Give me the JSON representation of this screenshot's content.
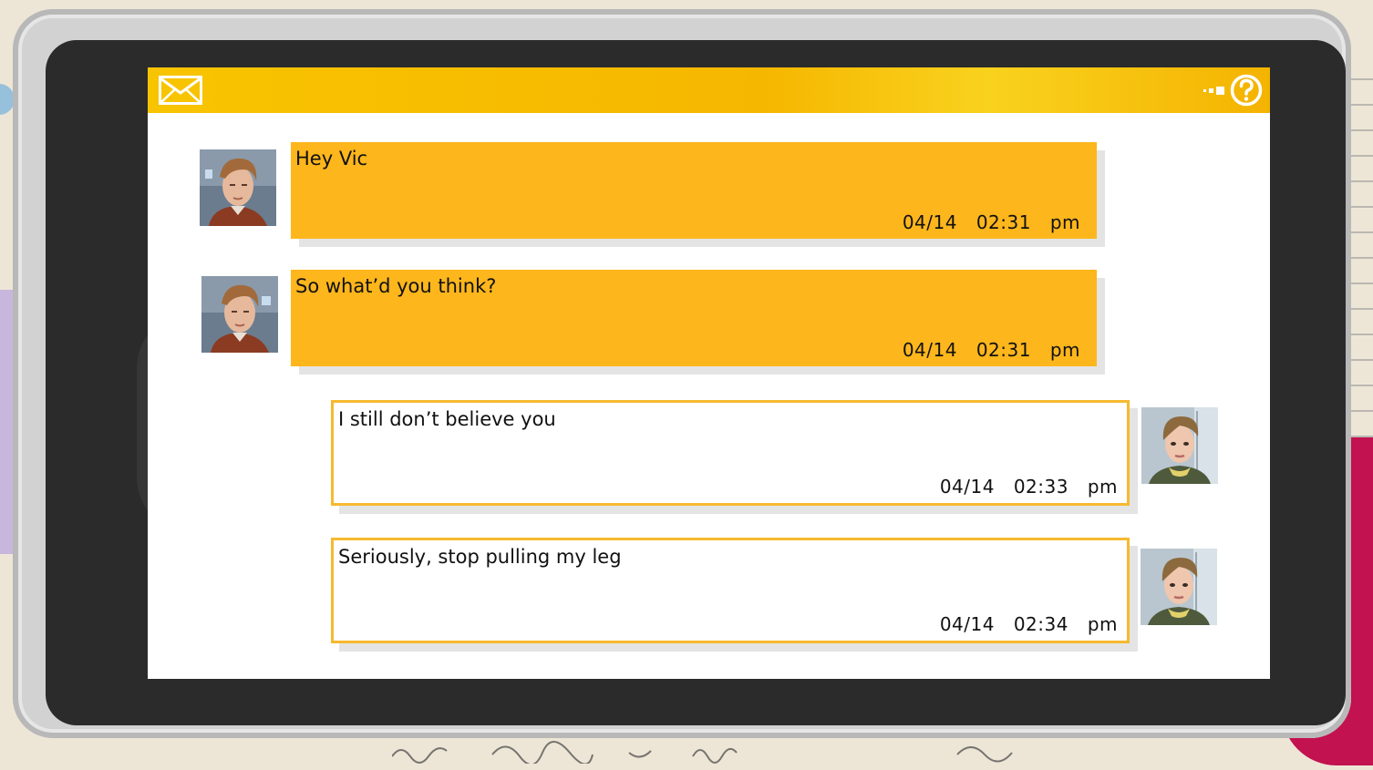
{
  "app": {
    "header_icons": [
      "mail-icon",
      "signal-icon",
      "help-icon"
    ]
  },
  "messages": [
    {
      "sender": "contact",
      "text": "Hey Vic",
      "date": "04/14",
      "time": "02:31 pm"
    },
    {
      "sender": "contact",
      "text": "So what’d you think?",
      "date": "04/14",
      "time": "02:31 pm"
    },
    {
      "sender": "self",
      "text": "I still don’t believe you",
      "date": "04/14",
      "time": "02:33 pm"
    },
    {
      "sender": "self",
      "text": "Seriously, stop pulling my leg",
      "date": "04/14",
      "time": "02:34 pm"
    }
  ],
  "colors": {
    "header": "#f8c400",
    "incoming_bubble": "#fdb61c",
    "outgoing_border": "#f7b930",
    "bezel": "#2b2b2b"
  }
}
